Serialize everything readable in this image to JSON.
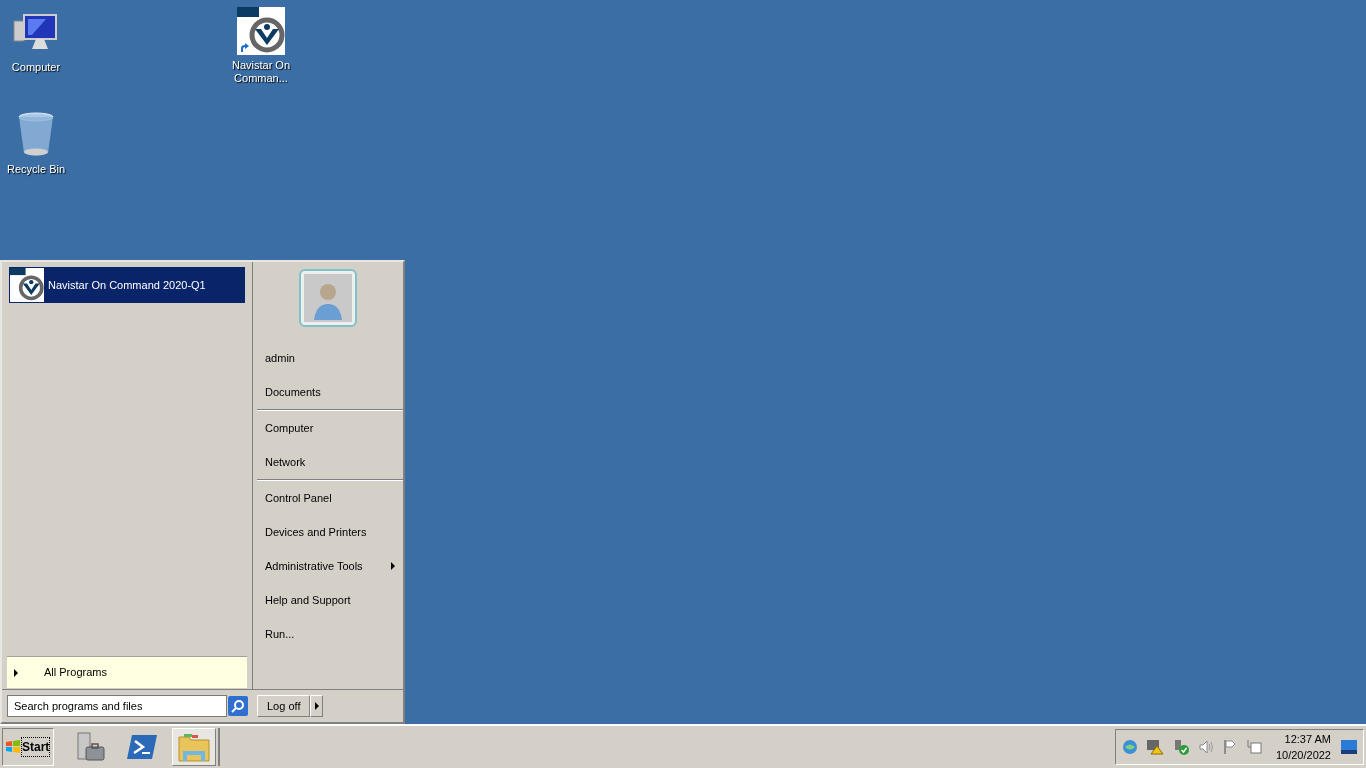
{
  "desktop_icons": [
    {
      "label": "Computer",
      "kind": "computer"
    },
    {
      "label": "Recycle Bin",
      "kind": "recycle"
    },
    {
      "label": "Navistar On Comman...",
      "kind": "navistar"
    }
  ],
  "start_menu": {
    "programs": [
      {
        "label": "Navistar On Command 2020-Q1",
        "selected": true
      }
    ],
    "all_programs": "All Programs",
    "search": {
      "placeholder": "Search programs and files"
    },
    "right_groups": [
      [
        {
          "label": "admin",
          "submenu": false
        },
        {
          "label": "Documents",
          "submenu": false
        }
      ],
      [
        {
          "label": "Computer",
          "submenu": false
        },
        {
          "label": "Network",
          "submenu": false
        }
      ],
      [
        {
          "label": "Control Panel",
          "submenu": false
        },
        {
          "label": "Devices and Printers",
          "submenu": false
        },
        {
          "label": "Administrative Tools",
          "submenu": true
        },
        {
          "label": "Help and Support",
          "submenu": false
        },
        {
          "label": "Run...",
          "submenu": false
        }
      ]
    ],
    "log_off": "Log off"
  },
  "taskbar": {
    "start": "Start",
    "pinned": [
      {
        "kind": "server",
        "selected": false
      },
      {
        "kind": "powershell",
        "selected": false
      },
      {
        "kind": "explorer",
        "selected": true
      }
    ],
    "clock": {
      "time": "12:37 AM",
      "date": "10/20/2022"
    }
  }
}
